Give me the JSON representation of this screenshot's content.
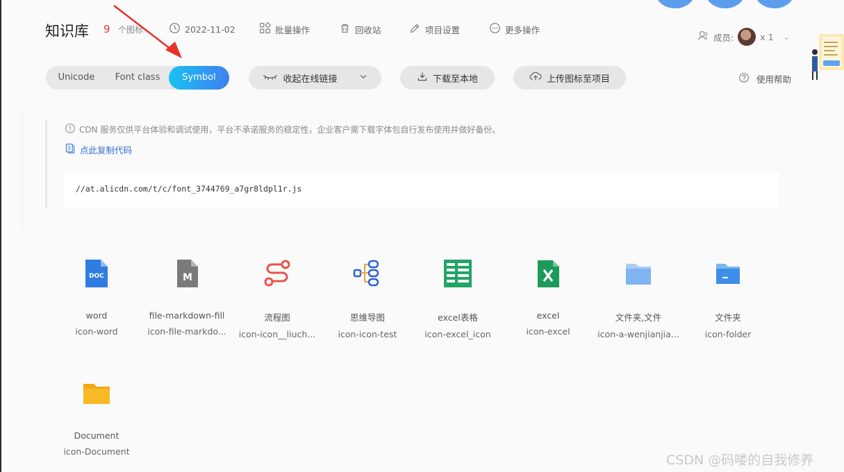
{
  "header": {
    "title": "知识库",
    "icon_count": "9",
    "icon_count_label": "个图标",
    "date": "2022-11-02",
    "batch_ops": "批量操作",
    "recycle_bin": "回收站",
    "project_settings": "项目设置",
    "more_ops": "更多操作",
    "members_label": "成员:",
    "members_count": "x 1"
  },
  "tabs": [
    {
      "label": "Unicode",
      "active": false
    },
    {
      "label": "Font class",
      "active": false
    },
    {
      "label": "Symbol",
      "active": true
    }
  ],
  "actions": {
    "collapse_link": "收起在线链接",
    "download": "下载至本地",
    "upload": "上传图标至项目",
    "help": "使用帮助"
  },
  "cdn": {
    "notice": "CDN 服务仅供平台体验和调试使用，平台不承诺服务的稳定性，企业客户需下载字体包自行发布使用并做好备份。",
    "copy_code": "点此复制代码",
    "code": "//at.alicdn.com/t/c/font_3744769_a7gr8ldpl1r.js"
  },
  "icons": [
    {
      "name": "word",
      "code": "icon-word",
      "icon": "doc-file-icon",
      "color": "#2f7de1"
    },
    {
      "name": "file-markdown-fill",
      "code": "icon-file-markdo...",
      "icon": "markdown-file-icon",
      "color": "#7a7a7a"
    },
    {
      "name": "流程图",
      "code": "icon-icon__liuch...",
      "icon": "flowchart-icon",
      "color": "#e8544c"
    },
    {
      "name": "思维导图",
      "code": "icon-icon-test",
      "icon": "mindmap-icon",
      "color": "#2d62d6"
    },
    {
      "name": "excel表格",
      "code": "icon-excel_icon",
      "icon": "spreadsheet-icon",
      "color": "#21a466"
    },
    {
      "name": "excel",
      "code": "icon-excel",
      "icon": "excel-file-icon",
      "color": "#1d9b5a"
    },
    {
      "name": "文件夹,文件",
      "code": "icon-a-wenjianjia...",
      "icon": "folder-light-icon",
      "color": "#7fb4f0"
    },
    {
      "name": "文件夹",
      "code": "icon-folder",
      "icon": "folder-blue-icon",
      "color": "#3d8ee8"
    },
    {
      "name": "Document",
      "code": "icon-Document",
      "icon": "folder-yellow-icon",
      "color": "#f7b925"
    }
  ],
  "watermark": "CSDN @码喽的自我修养",
  "colors": {
    "accent_gradient_start": "#18c2f0",
    "accent_gradient_end": "#3f7ff0",
    "count_red": "#e03a3a",
    "annotation_arrow": "#e8312a"
  }
}
